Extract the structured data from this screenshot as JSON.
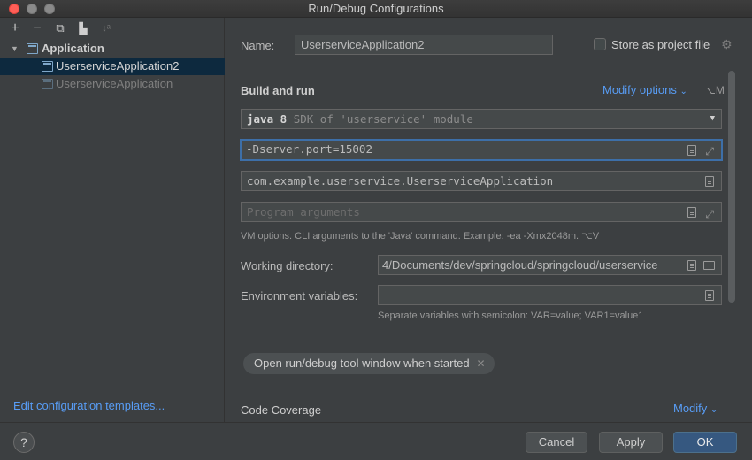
{
  "window": {
    "title": "Run/Debug Configurations"
  },
  "toolbar": {
    "add": "+",
    "remove": "−",
    "copy": "⧉",
    "folder": "▙",
    "sort": "↓ᵃ"
  },
  "tree": {
    "group_label": "Application",
    "items": [
      {
        "label": "UserserviceApplication2",
        "selected": true
      },
      {
        "label": "UserserviceApplication",
        "selected": false
      }
    ]
  },
  "left_footer": {
    "edit_templates": "Edit configuration templates..."
  },
  "config": {
    "name_label": "Name:",
    "name_value": "UserserviceApplication2",
    "store_label": "Store as project file",
    "build_run_title": "Build and run",
    "modify_options": "Modify options",
    "modify_options_shortcut": "⌥M",
    "sdk_bold": "java 8",
    "sdk_rest": "SDK of 'userservice' module",
    "vm_options_value": "-Dserver.port=15002",
    "main_class_value": "com.example.userservice.UserserviceApplication",
    "program_args_placeholder": "Program arguments",
    "vm_hint": "VM options. CLI arguments to the 'Java' command. Example: -ea -Xmx2048m. ⌥V",
    "working_dir_label": "Working directory:",
    "working_dir_value": "4/Documents/dev/springcloud/springcloud/userservice",
    "env_label": "Environment variables:",
    "env_value": "",
    "env_hint": "Separate variables with semicolon: VAR=value; VAR1=value1",
    "chip_label": "Open run/debug tool window when started",
    "code_coverage_title": "Code Coverage",
    "code_coverage_modify": "Modify"
  },
  "footer": {
    "help": "?",
    "cancel": "Cancel",
    "apply": "Apply",
    "ok": "OK"
  },
  "colors": {
    "accent": "#589df6",
    "selection": "#0d293e",
    "primary_button": "#365880"
  }
}
